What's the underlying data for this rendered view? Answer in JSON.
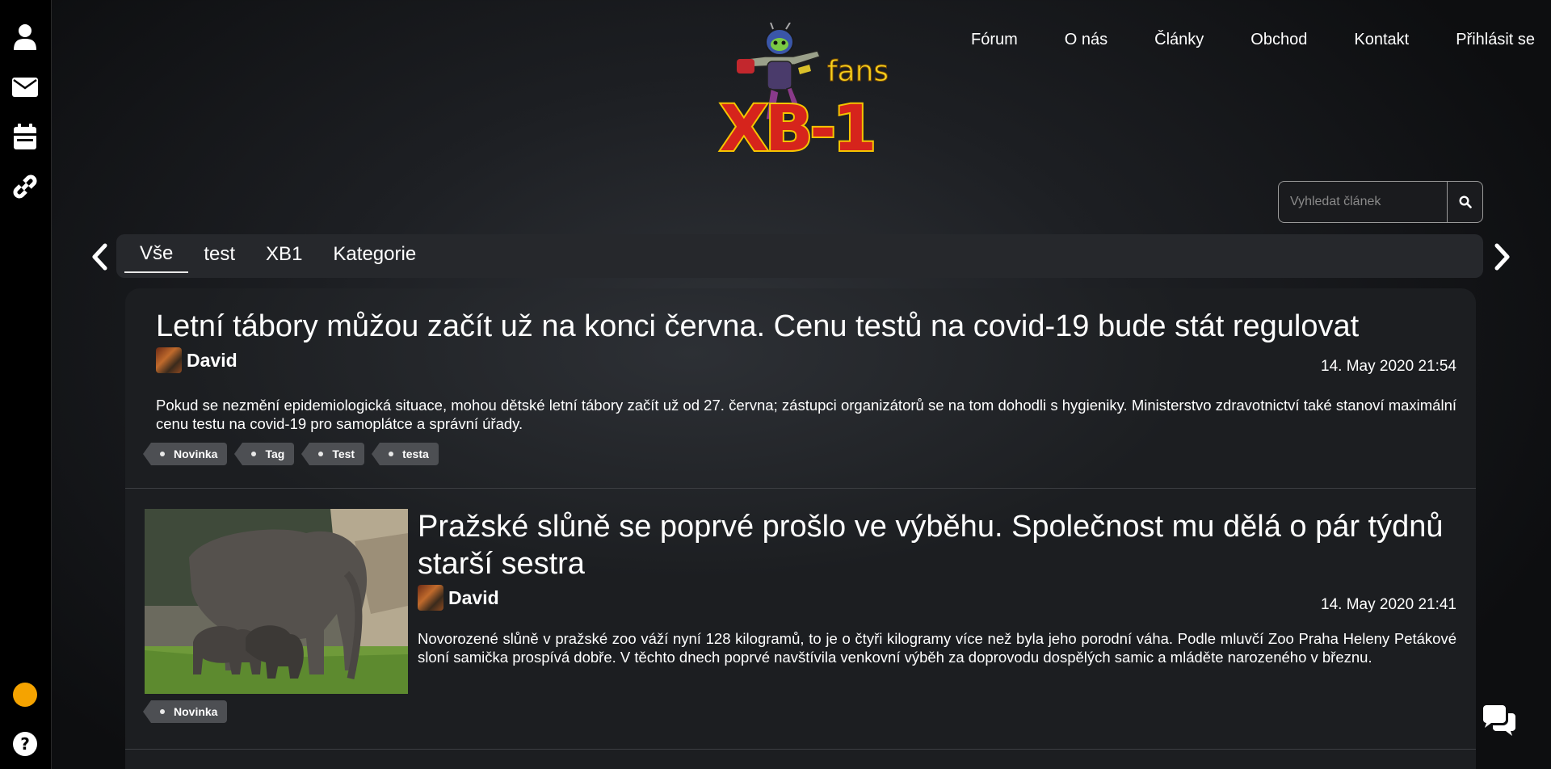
{
  "sidebar": {
    "icons": [
      "user-icon",
      "envelope-icon",
      "calendar-icon",
      "link-icon",
      "status-dot",
      "help-icon"
    ],
    "status_color": "#f5a300"
  },
  "logo": {
    "top_text": "fans",
    "main_text": "XB-1"
  },
  "nav": {
    "items": [
      "Fórum",
      "O nás",
      "Články",
      "Obchod",
      "Kontakt",
      "Přihlásit se"
    ]
  },
  "search": {
    "placeholder": "Vyhledat článek",
    "icon": "search-icon"
  },
  "categories": {
    "prev_icon": "chevron-left-icon",
    "next_icon": "chevron-right-icon",
    "tabs": [
      "Vše",
      "test",
      "XB1",
      "Kategorie"
    ],
    "active": "Vše"
  },
  "articles": [
    {
      "title": "Letní tábory můžou začít už na konci června. Cenu testů na covid-19 bude stát regulovat",
      "author": "David",
      "date": "14. May 2020 21:54",
      "excerpt": "Pokud se nezmění epidemiologická situace, mohou dětské letní tábory začít už od 27. června; zástupci organizátorů se na tom dohodli s hygieniky. Ministerstvo zdravotnictví také stanoví maximální cenu testu na covid-19 pro samoplátce a správní úřady.",
      "tags": [
        "Novinka",
        "Tag",
        "Test",
        "testa"
      ]
    },
    {
      "title": "Pražské slůně se poprvé prošlo ve výběhu. Společnost mu dělá o pár týdnů starší sestra",
      "author": "David",
      "date": "14. May 2020 21:41",
      "excerpt": "Novorozené slůně v pražské zoo váží nyní 128 kilogramů, to je o čtyři kilogramy více než byla jeho porodní váha. Podle mluvčí Zoo Praha Heleny Petákové sloní samička prospívá dobře. V těchto dnech poprvé navštívila venkovní výběh za doprovodu dospělých samic a mláděte narozeného v březnu.",
      "tags": [
        "Novinka"
      ]
    }
  ],
  "colors": {
    "accent": "#f5a300",
    "tag_bg": "#4d4f53"
  },
  "chat_icon": "chat-icon"
}
